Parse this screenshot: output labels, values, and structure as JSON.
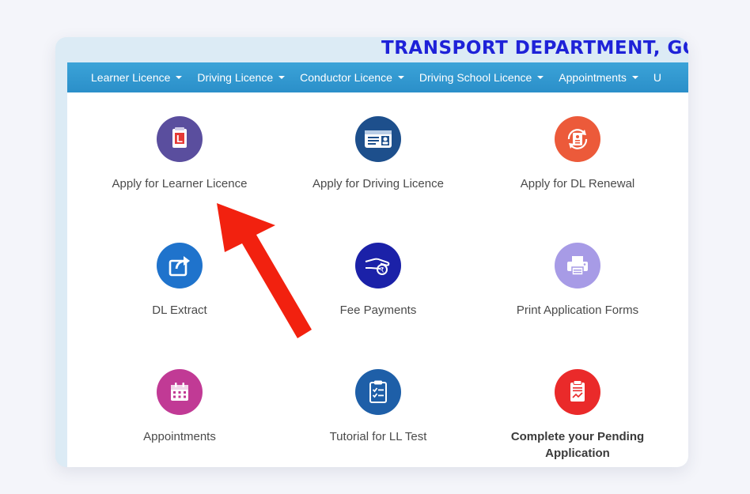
{
  "header": {
    "title": "TRANSPORT DEPARTMENT, GOV"
  },
  "nav": [
    {
      "label": "Learner Licence"
    },
    {
      "label": "Driving Licence"
    },
    {
      "label": "Conductor Licence"
    },
    {
      "label": "Driving School Licence"
    },
    {
      "label": "Appointments"
    },
    {
      "label": "U"
    }
  ],
  "services": [
    {
      "label": "Apply for Learner Licence",
      "icon": "learner-licence-icon",
      "color": "#5a4e9e"
    },
    {
      "label": "Apply for Driving Licence",
      "icon": "driving-licence-card-icon",
      "color": "#1d4f8c"
    },
    {
      "label": "Apply for DL Renewal",
      "icon": "renewal-icon",
      "color": "#ec5a3a"
    },
    {
      "label": "DL Extract",
      "icon": "share-extract-icon",
      "color": "#1f73cc"
    },
    {
      "label": "Fee Payments",
      "icon": "fee-payment-icon",
      "color": "#1b21a8"
    },
    {
      "label": "Print Application Forms",
      "icon": "printer-icon",
      "color": "#a79be6"
    },
    {
      "label": "Appointments",
      "icon": "calendar-icon",
      "color": "#c13a95"
    },
    {
      "label": "Tutorial for LL Test",
      "icon": "checklist-icon",
      "color": "#1e5fa8"
    },
    {
      "label": "Complete your Pending\nApplication",
      "icon": "pending-application-icon",
      "color": "#ea2a2a"
    }
  ],
  "colors": {
    "navbar": "#2b8fc9",
    "title": "#1e22d8",
    "annotation_arrow": "#f2210f"
  }
}
